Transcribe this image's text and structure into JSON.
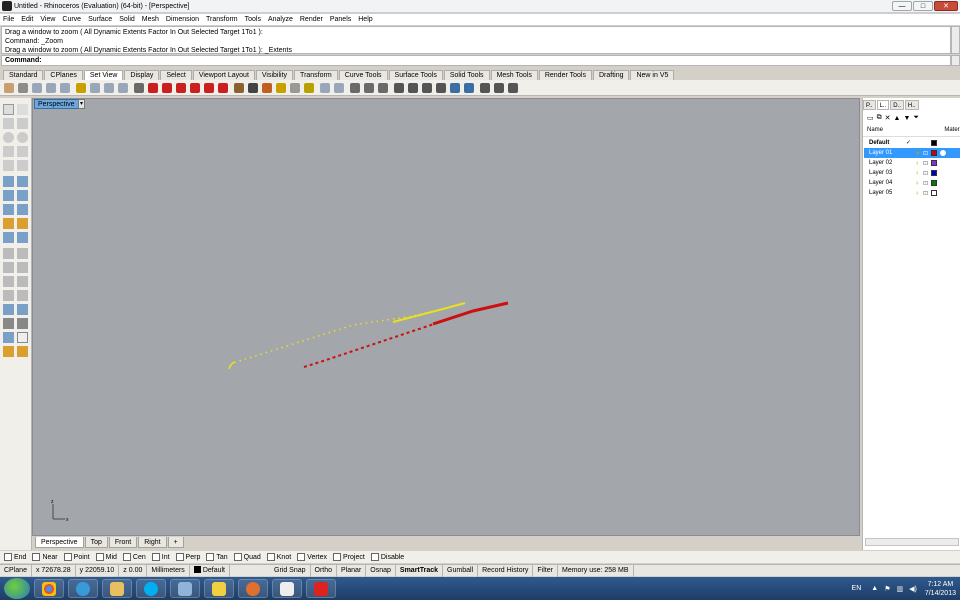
{
  "window": {
    "title": "Untitled - Rhinoceros (Evaluation) (64-bit) - [Perspective]"
  },
  "menu": [
    "File",
    "Edit",
    "View",
    "Curve",
    "Surface",
    "Solid",
    "Mesh",
    "Dimension",
    "Transform",
    "Tools",
    "Analyze",
    "Render",
    "Panels",
    "Help"
  ],
  "command_history": [
    "Drag a window to zoom ( All  Dynamic  Extents  Factor  In  Out  Selected  Target  1To1 ):",
    "Command: _Zoom",
    "Drag a window to zoom ( All  Dynamic  Extents  Factor  In  Out  Selected  Target  1To1 ): _Extents"
  ],
  "command_prompt": {
    "label": "Command:",
    "value": ""
  },
  "toolbar_tabs": [
    "Standard",
    "CPlanes",
    "Set View",
    "Display",
    "Select",
    "Viewport Layout",
    "Visibility",
    "Transform",
    "Curve Tools",
    "Surface Tools",
    "Solid Tools",
    "Mesh Tools",
    "Render Tools",
    "Drafting",
    "New in V5"
  ],
  "active_toolbar_tab": "Set View",
  "viewport": {
    "name": "Perspective",
    "axis_x": "x",
    "axis_z": "z"
  },
  "viewport_tabs": [
    "Perspective",
    "Top",
    "Front",
    "Right"
  ],
  "active_viewport_tab": "Perspective",
  "panel": {
    "tabs": [
      "P..",
      "L..",
      "D..",
      "H.."
    ],
    "columns": {
      "name": "Name",
      "material": "Materi"
    },
    "layers": [
      {
        "name": "Default",
        "color": "#000000",
        "current": true,
        "bold": true
      },
      {
        "name": "Layer 01",
        "color": "#cc0000",
        "selected": true
      },
      {
        "name": "Layer 02",
        "color": "#8a2be2"
      },
      {
        "name": "Layer 03",
        "color": "#0000cc"
      },
      {
        "name": "Layer 04",
        "color": "#008000"
      },
      {
        "name": "Layer 05",
        "color": "#ffffff"
      }
    ],
    "current_mark": "✓"
  },
  "osnaps": [
    "End",
    "Near",
    "Point",
    "Mid",
    "Cen",
    "Int",
    "Perp",
    "Tan",
    "Quad",
    "Knot",
    "Vertex",
    "Project",
    "Disable"
  ],
  "status": {
    "cplane": "CPlane",
    "x": "x 72678.28",
    "y": "y 22059.10",
    "z": "z 0.00",
    "units": "Millimeters",
    "layer": "Default",
    "grid_snap": "Grid Snap",
    "ortho": "Ortho",
    "planar": "Planar",
    "osnap": "Osnap",
    "smarttrack": "SmartTrack",
    "gumball": "Gumball",
    "record_history": "Record History",
    "filter": "Filter",
    "memory": "Memory use: 258 MB"
  },
  "taskbar": {
    "lang": "EN",
    "time": "7:12 AM",
    "date": "7/14/2013"
  },
  "colors": {
    "yellow_curve": "#e8e020",
    "red_curve": "#cc1010",
    "viewport_bg": "#a3a6aa"
  }
}
